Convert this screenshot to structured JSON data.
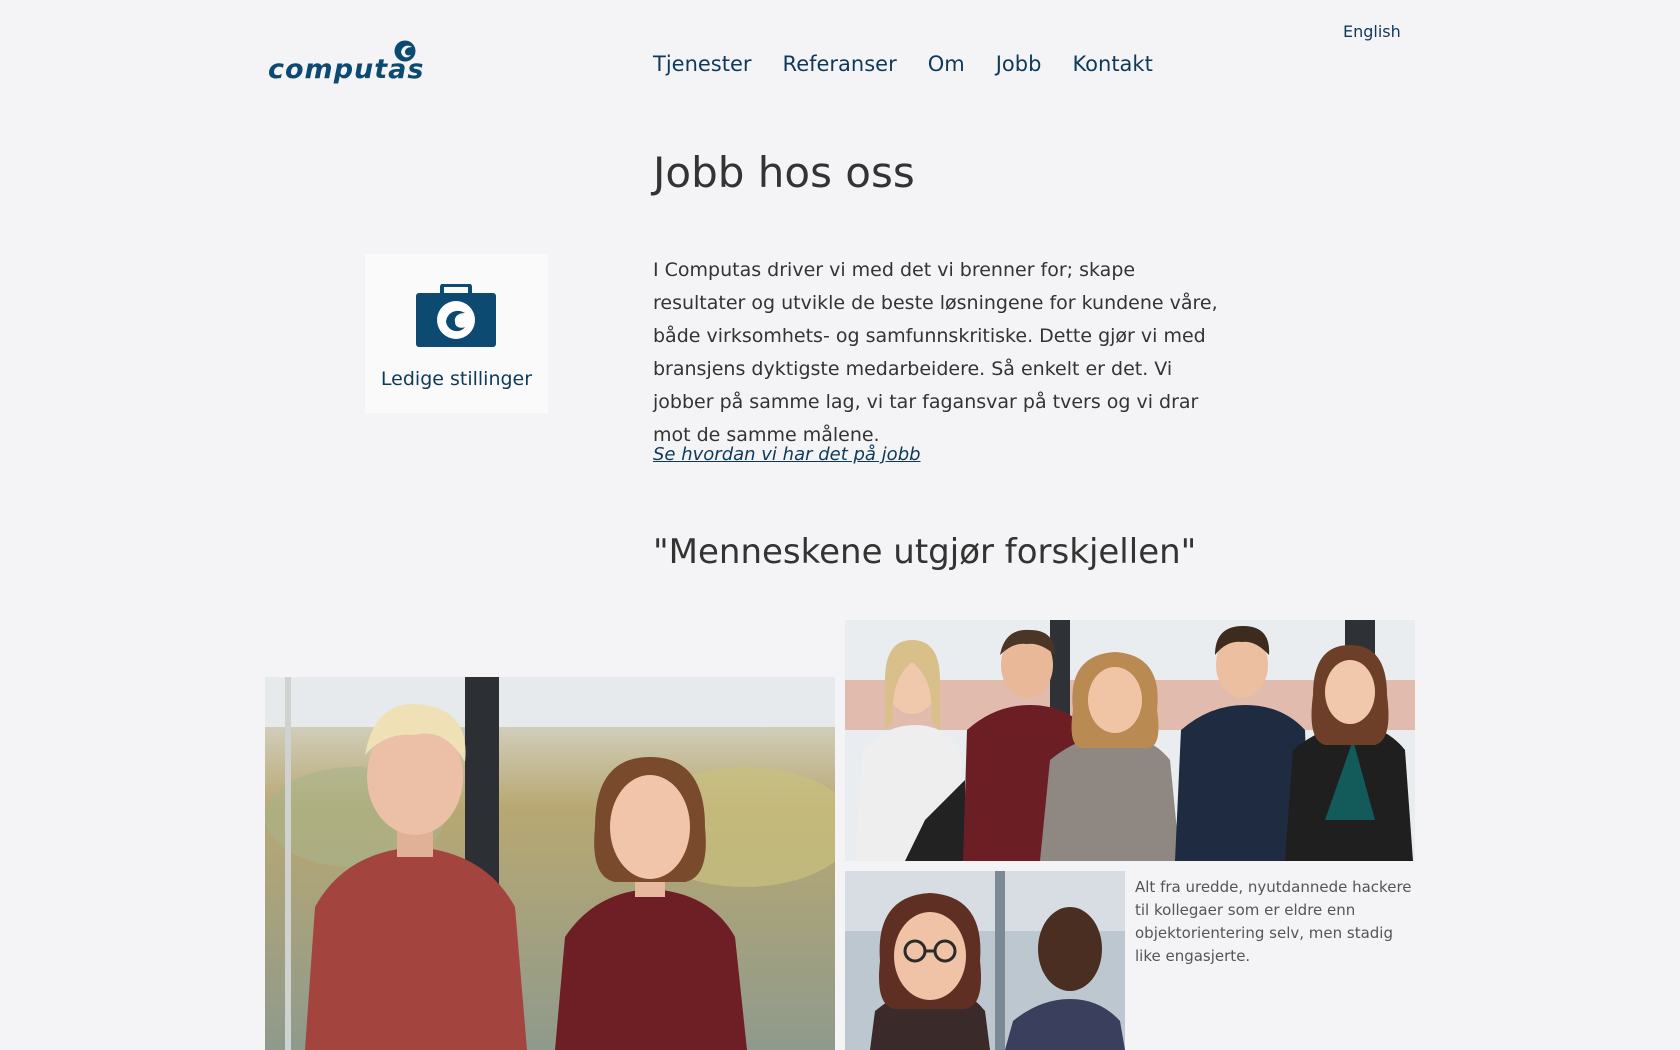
{
  "header": {
    "language_link": "English",
    "logo_text": "computas",
    "nav": [
      "Tjenester",
      "Referanser",
      "Om",
      "Jobb",
      "Kontakt"
    ]
  },
  "main": {
    "title": "Jobb hos oss",
    "jobs_card": {
      "label": "Ledige stillinger",
      "icon": "briefcase-icon"
    },
    "intro_text": "I Computas driver vi med det vi brenner for; skape resultater og utvikle de beste løsningene for kundene våre, både virksomhets- og samfunnskritiske. Dette gjør vi med bransjens dyktigste medarbeidere. Så enkelt er det. Vi jobber på samme lag, vi tar fagansvar på tvers og vi drar mot de samme målene.",
    "intro_link": "Se hvordan vi har det på jobb",
    "quote_heading": "\"Menneskene utgjør forskjellen\"",
    "caption": "Alt fra uredde, nyutdannede hackere til kollegaer som er eldre enn objektorientering selv, men stadig like engasjerte."
  },
  "colors": {
    "background": "#f4f4f6",
    "brand": "#0d4a72",
    "text": "#333333"
  }
}
